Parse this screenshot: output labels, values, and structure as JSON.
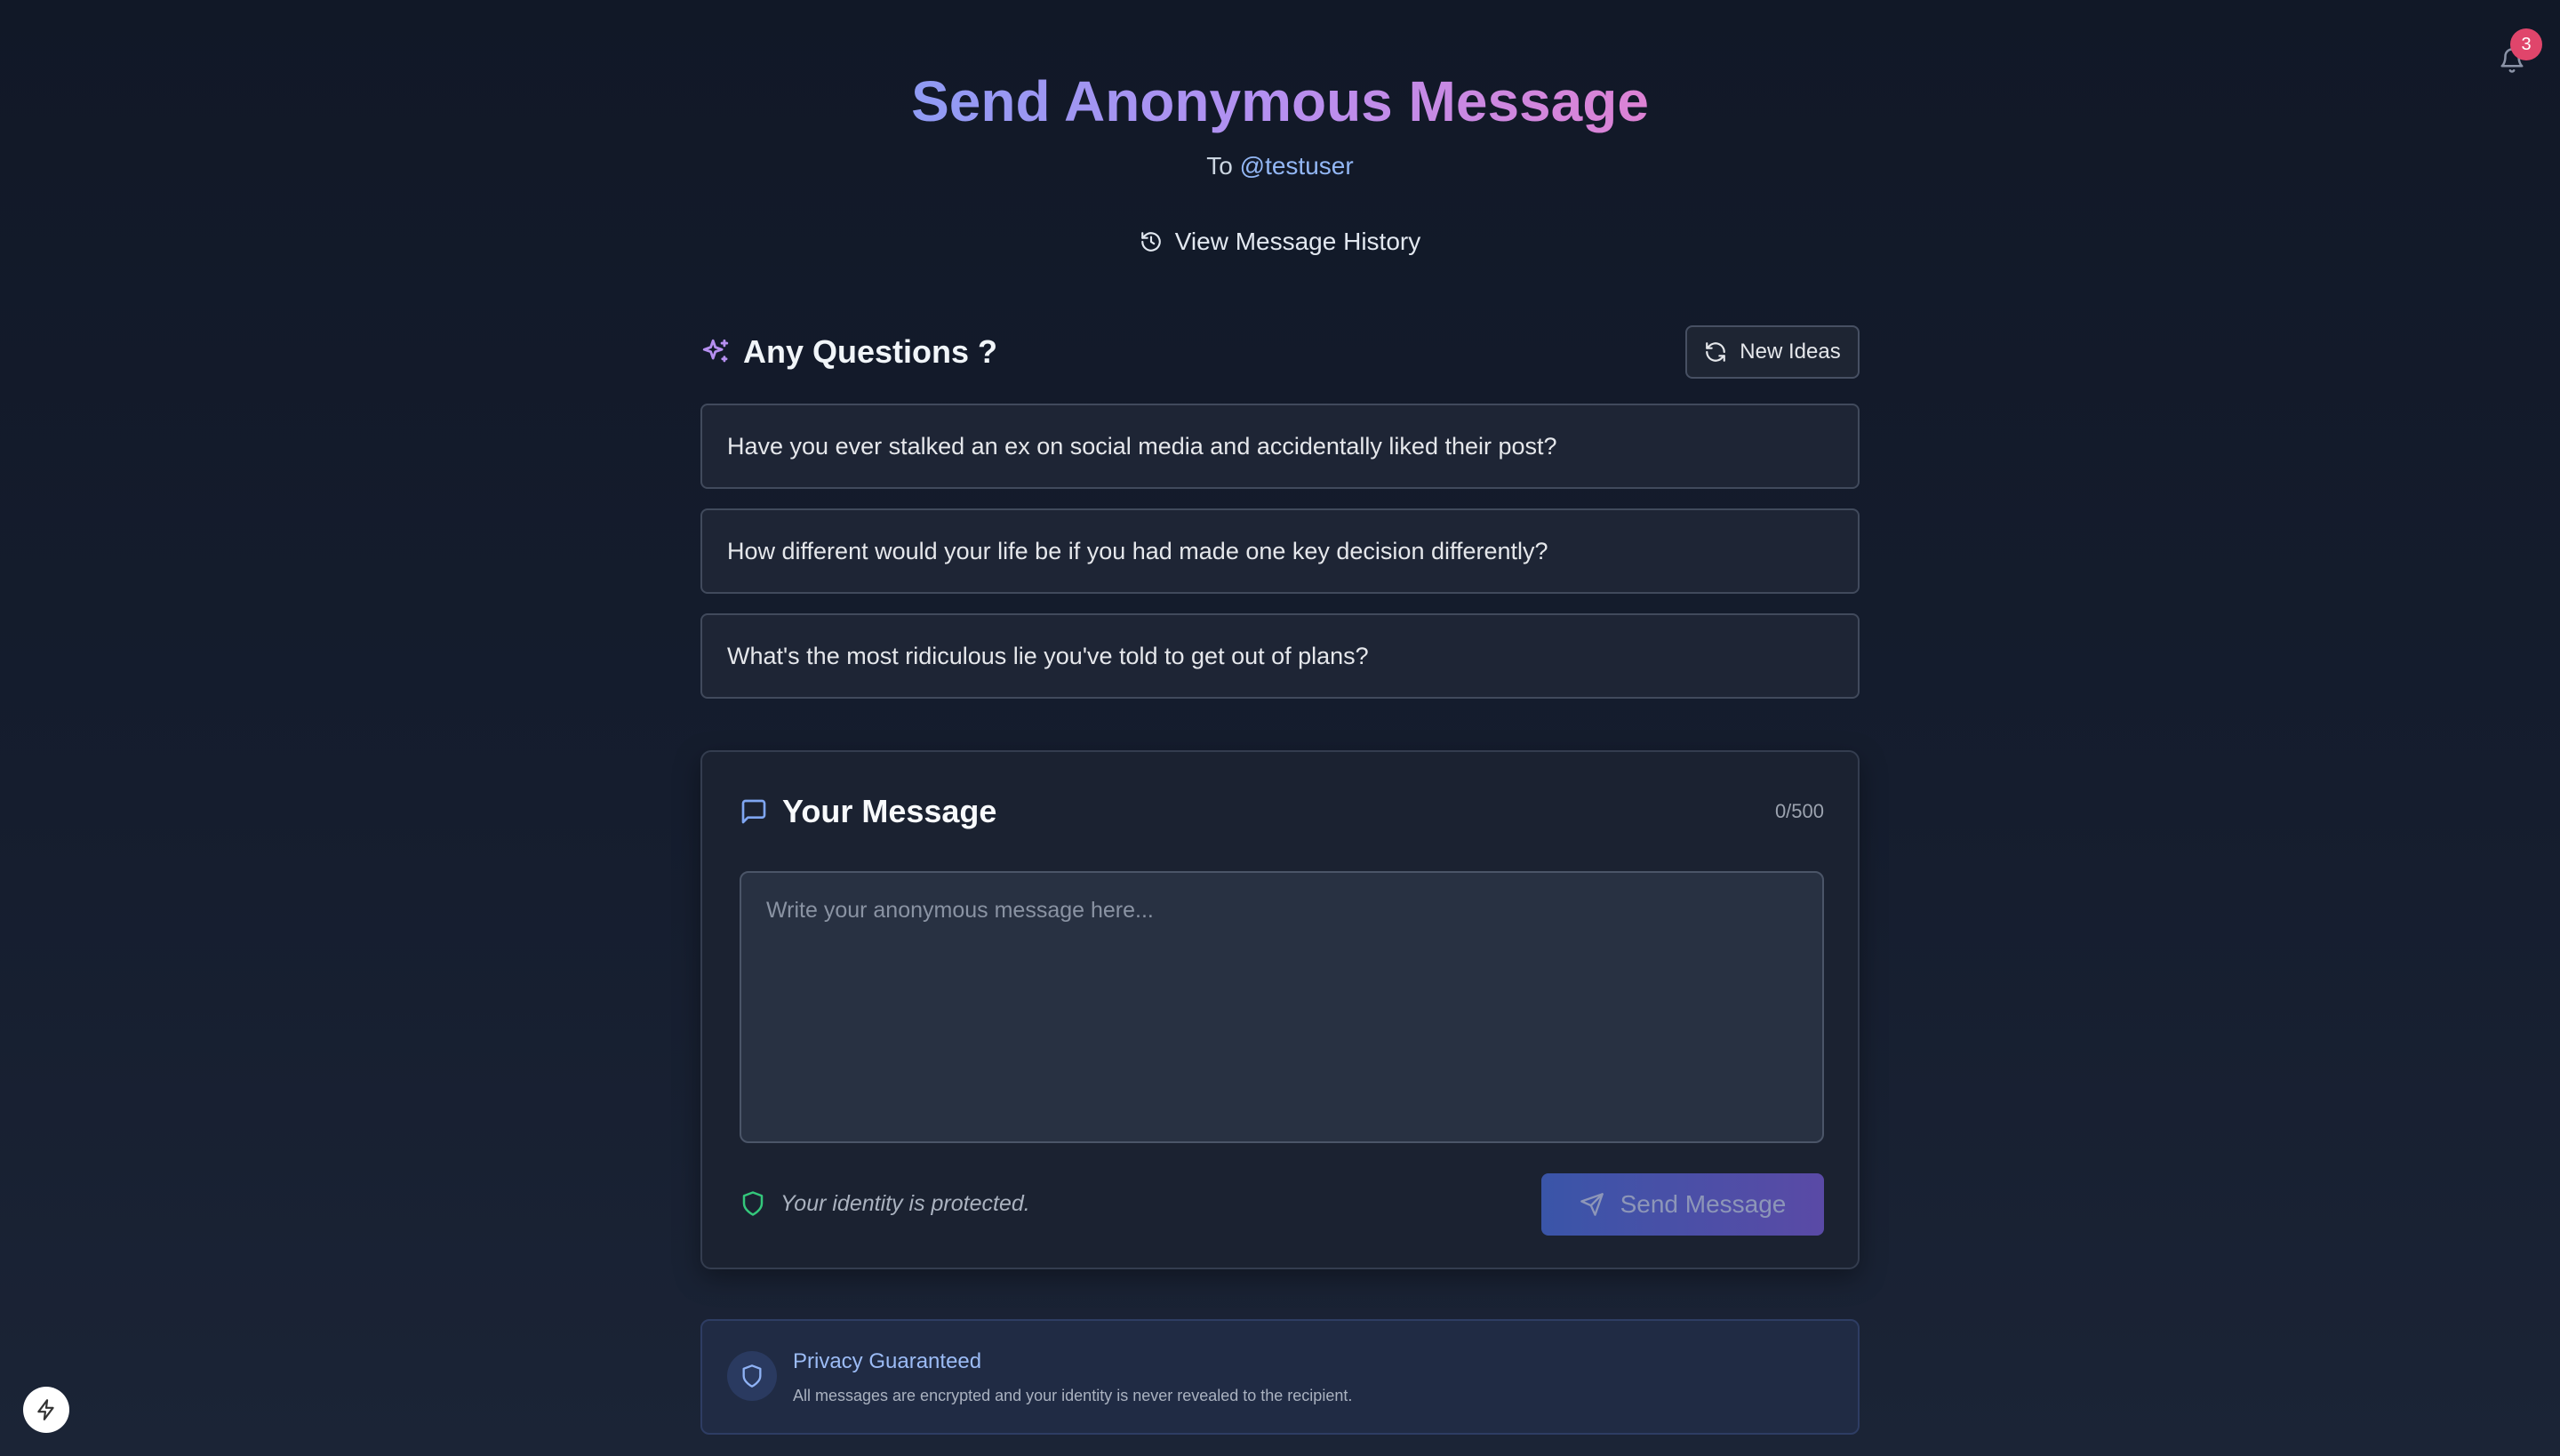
{
  "header": {
    "title": "Send Anonymous Message",
    "subtitle_prefix": "To",
    "username": "@testuser",
    "history_label": "View Message History"
  },
  "notifications": {
    "count": "3",
    "icon": "bell-icon"
  },
  "questions": {
    "title": "Any Questions ?",
    "refresh_label": "New Ideas",
    "items": [
      {
        "text": "Have you ever stalked an ex on social media and accidentally liked their post?"
      },
      {
        "text": "How different would your life be if you had made one key decision differently?"
      },
      {
        "text": "What's the most ridiculous lie you've told to get out of plans?"
      }
    ]
  },
  "message": {
    "title": "Your Message",
    "counter": "0/500",
    "value": "",
    "placeholder": "Write your anonymous message here...",
    "identity_note": "Your identity is protected.",
    "send_label": "Send Message"
  },
  "privacy": {
    "title": "Privacy Guaranteed",
    "text": "All messages are encrypted and your identity is never revealed to the recipient."
  },
  "colors": {
    "background": "#111827",
    "accent_blue": "#93b7f5",
    "accent_purple": "#b68ff0",
    "badge": "#e0456b",
    "shield_green": "#34c77b"
  }
}
